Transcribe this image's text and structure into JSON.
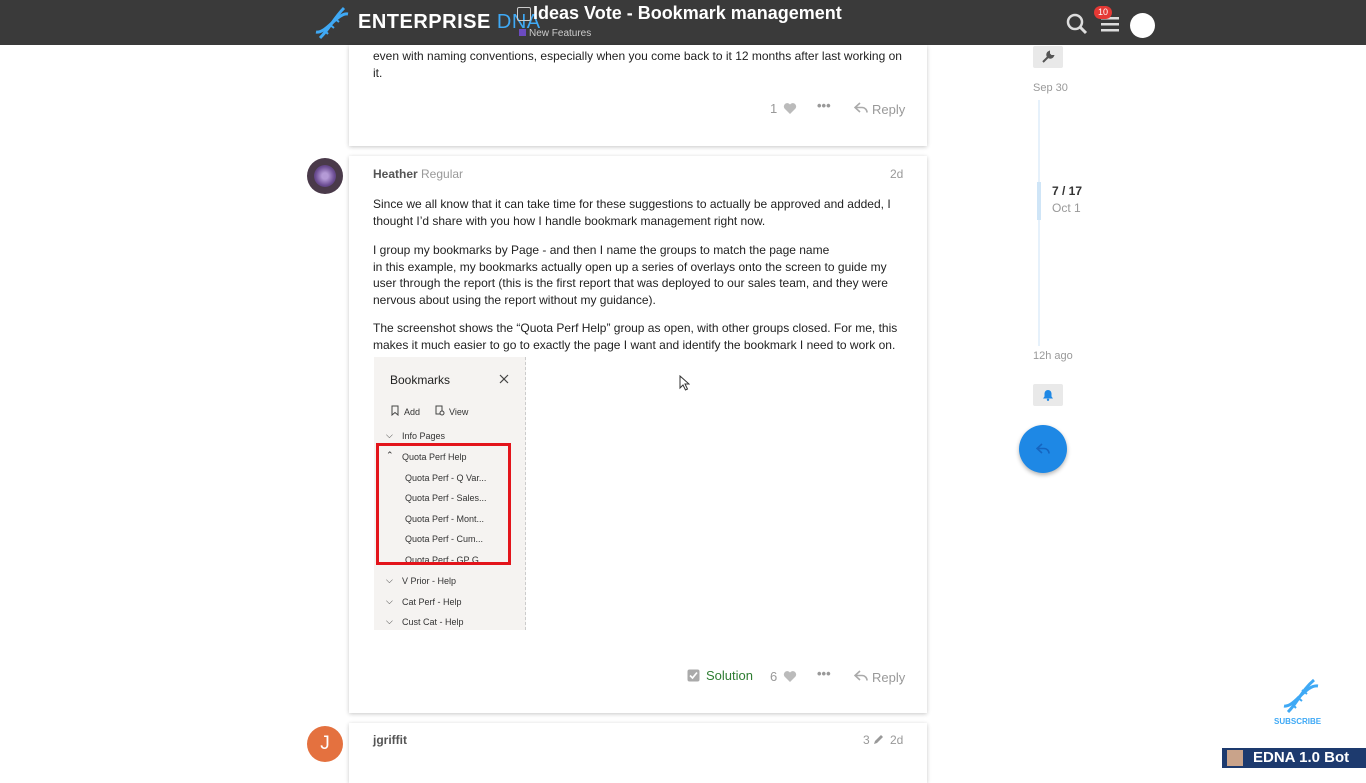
{
  "header": {
    "brand_main": "ENTERPRISE",
    "brand_accent": "DNA",
    "topic_title": "Ideas Vote - Bookmark management",
    "category": "New Features",
    "notification_count": "10"
  },
  "prev_post": {
    "text": "even with naming conventions, especially when you come back to it 12 months after last working on it.",
    "likes": "1",
    "reply_label": "Reply"
  },
  "post": {
    "username": "Heather",
    "user_title": "Regular",
    "age": "2d",
    "p1": "Since we all know that it can take time for these suggestions to actually be approved and added, I thought I’d share with you how I handle bookmark management right now.",
    "p2a": "I group my bookmarks by Page - and then I name the groups to match the page name",
    "p2b": "in this example, my bookmarks actually open up a series of overlays onto the screen to guide my user through the report (this is the first report that was deployed to our sales team, and they were nervous about using the report without my guidance).",
    "p3": "The screenshot shows the “Quota Perf Help” group as open, with other groups closed. For me, this makes it much easier to go to exactly the page I want and identify the bookmark I need to work on.",
    "solution_label": "Solution",
    "likes": "6",
    "reply_label": "Reply"
  },
  "bookmarks": {
    "title": "Bookmarks",
    "add_label": "Add",
    "view_label": "View",
    "groups": [
      "Info Pages",
      "Quota Perf Help",
      "V Prior - Help",
      "Cat Perf - Help",
      "Cust Cat - Help"
    ],
    "items": [
      "Quota Perf - Q Var...",
      "Quota Perf - Sales...",
      "Quota Perf - Mont...",
      "Quota Perf - Cum...",
      "Quota Perf - GP G..."
    ],
    "highlight_color": "#e3141b"
  },
  "next_post": {
    "username": "jgriffit",
    "avatar_letter": "J",
    "avatar_color": "#e4713f",
    "edit_count": "3",
    "age": "2d"
  },
  "timeline": {
    "start_date": "Sep 30",
    "position": "7 / 17",
    "position_date": "Oct 1",
    "end_label": "12h ago"
  },
  "subscribe_label": "SUBSCRIBE",
  "bot_label": "EDNA 1.0 Bot"
}
